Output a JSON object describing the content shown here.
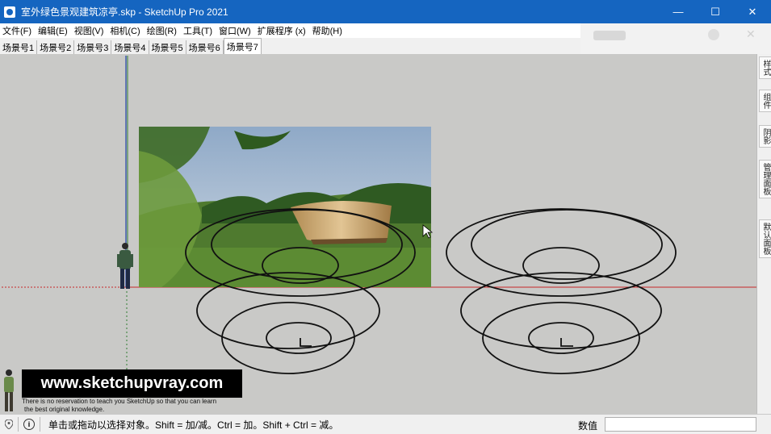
{
  "window": {
    "title": "室外绿色景观建筑凉亭.skp - SketchUp Pro 2021",
    "controls": [
      "—",
      "☐",
      "✕"
    ]
  },
  "menu": [
    "文件(F)",
    "编辑(E)",
    "视图(V)",
    "相机(C)",
    "绘图(R)",
    "工具(T)",
    "窗口(W)",
    "扩展程序 (x)",
    "帮助(H)"
  ],
  "scenes": {
    "tabs": [
      "场景号1",
      "场景号2",
      "场景号3",
      "场景号4",
      "场景号5",
      "场景号6",
      "场景号7"
    ],
    "active_index": 6
  },
  "tray_tabs": [
    "样式",
    "组件",
    "阴影",
    "管理面板",
    "默认面板"
  ],
  "watermark": {
    "url": "www.sketchupvray.com",
    "line1": "There is no reservation to teach you SketchUp so that you can learn",
    "line2": "the best original knowledge."
  },
  "status": {
    "hint": "单击或拖动以选择对象。Shift = 加/减。Ctrl = 加。Shift + Ctrl = 减。",
    "measure_label": "数值",
    "measure_value": ""
  },
  "colors": {
    "titlebar": "#1565c0",
    "viewport_bg": "#c9c9c7",
    "red_axis": "#c62828",
    "green_axis": "#2e7d32",
    "blue_axis": "#1e3fa8"
  }
}
